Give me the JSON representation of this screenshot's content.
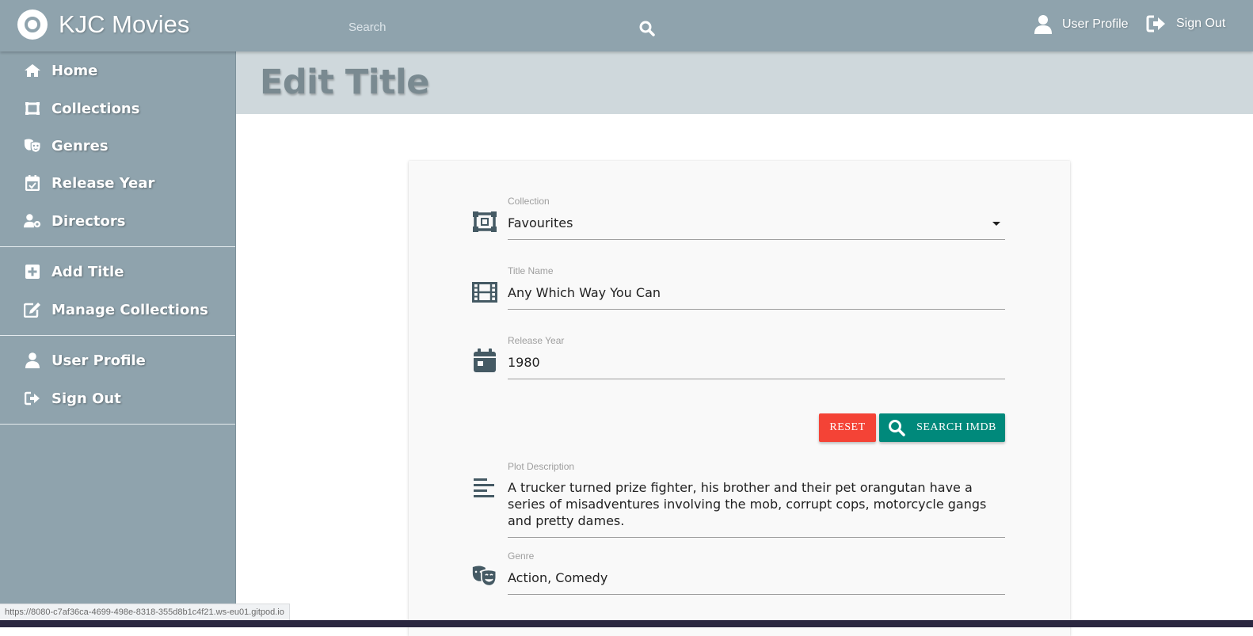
{
  "app": {
    "brand_name": "KJC Movies",
    "colors": {
      "navbar": "#8fa3ad",
      "header_band": "#cfd8dc",
      "reset_button": "#f44336",
      "imdb_button": "#00897b"
    }
  },
  "search": {
    "placeholder": "Search"
  },
  "topnav": {
    "user_profile": "User Profile",
    "sign_out": "Sign Out"
  },
  "sidebar": {
    "items": [
      {
        "label": "Home",
        "icon": "home-icon"
      },
      {
        "label": "Collections",
        "icon": "collections-icon"
      },
      {
        "label": "Genres",
        "icon": "theater-masks-icon"
      },
      {
        "label": "Release Year",
        "icon": "calendar-check-icon"
      },
      {
        "label": "Directors",
        "icon": "user-cog-icon"
      },
      {
        "label": "Add Title",
        "icon": "plus-square-icon"
      },
      {
        "label": "Manage Collections",
        "icon": "edit-icon"
      },
      {
        "label": "User Profile",
        "icon": "user-icon"
      },
      {
        "label": "Sign Out",
        "icon": "sign-out-icon"
      }
    ]
  },
  "page": {
    "title": "Edit Title"
  },
  "form": {
    "collection": {
      "label": "Collection",
      "value": "Favourites"
    },
    "title_name": {
      "label": "Title Name",
      "value": "Any Which Way You Can"
    },
    "release_year": {
      "label": "Release Year",
      "value": "1980"
    },
    "buttons": {
      "reset": "RESET",
      "search_imdb": "SEARCH IMDB"
    },
    "plot": {
      "label": "Plot Description",
      "value": "A trucker turned prize fighter, his brother and their pet orangutan have a series of misadventures involving the mob, corrupt cops, motorcycle gangs and pretty dames."
    },
    "genre": {
      "label": "Genre",
      "value": "Action, Comedy"
    }
  },
  "status_bar": {
    "url": "https://8080-c7af36ca-4699-498e-8318-355d8b1c4f21.ws-eu01.gitpod.io"
  }
}
